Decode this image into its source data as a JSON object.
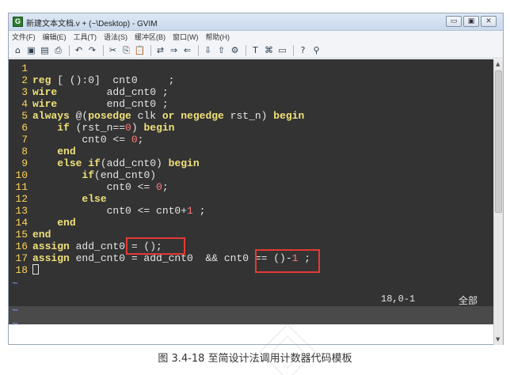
{
  "window": {
    "app_icon_letter": "G",
    "title": "新建文本文档.v + (~\\Desktop) - GVIM",
    "controls": [
      "▭",
      "▣",
      "✕"
    ]
  },
  "menu": [
    "文件(F)",
    "编辑(E)",
    "工具(T)",
    "语法(S)",
    "缓冲区(B)",
    "窗口(W)",
    "帮助(H)"
  ],
  "toolbar": {
    "icons": [
      "open-icon",
      "save-icon",
      "save-all-icon",
      "print-icon",
      "undo-icon",
      "redo-icon",
      "cut-icon",
      "copy-icon",
      "paste-icon",
      "find-replace-icon",
      "find-next-icon",
      "find-prev-icon",
      "load-session-icon",
      "save-session-icon",
      "run-script-icon",
      "make-icon",
      "shell-icon",
      "tags-icon",
      "help-icon",
      "find-help-icon"
    ],
    "glyphs": [
      "⌂",
      "▣",
      "▤",
      "⎙",
      "↶",
      "↷",
      "✂",
      "⎘",
      "📋",
      "⇄",
      "⇒",
      "⇐",
      "⇩",
      "⇧",
      "⚙",
      "T",
      "⌘",
      "▭",
      "?",
      "⚲"
    ]
  },
  "code_lines": [
    [
      {
        "t": "ln",
        "v": "1"
      }
    ],
    [
      {
        "t": "ln",
        "v": "2"
      },
      {
        "t": "kw",
        "v": "reg"
      },
      {
        "t": "txt",
        "v": " [ ():0]  cnt0     ;"
      }
    ],
    [
      {
        "t": "ln",
        "v": "3"
      },
      {
        "t": "kw",
        "v": "wire"
      },
      {
        "t": "txt",
        "v": "        add_cnt0 ;"
      }
    ],
    [
      {
        "t": "ln",
        "v": "4"
      },
      {
        "t": "kw",
        "v": "wire"
      },
      {
        "t": "txt",
        "v": "        end_cnt0 ;"
      }
    ],
    [
      {
        "t": "ln",
        "v": "5"
      },
      {
        "t": "kw",
        "v": "always"
      },
      {
        "t": "txt",
        "v": " @("
      },
      {
        "t": "kw",
        "v": "posedge"
      },
      {
        "t": "txt",
        "v": " clk "
      },
      {
        "t": "kw",
        "v": "or negedge"
      },
      {
        "t": "txt",
        "v": " rst_n) "
      },
      {
        "t": "kw",
        "v": "begin"
      }
    ],
    [
      {
        "t": "ln",
        "v": "6"
      },
      {
        "t": "txt",
        "v": "    "
      },
      {
        "t": "kw",
        "v": "if"
      },
      {
        "t": "txt",
        "v": " (rst_n=="
      },
      {
        "t": "num",
        "v": "0"
      },
      {
        "t": "txt",
        "v": ") "
      },
      {
        "t": "kw",
        "v": "begin"
      }
    ],
    [
      {
        "t": "ln",
        "v": "7"
      },
      {
        "t": "txt",
        "v": "        cnt0 <= "
      },
      {
        "t": "num",
        "v": "0"
      },
      {
        "t": "txt",
        "v": ";"
      }
    ],
    [
      {
        "t": "ln",
        "v": "8"
      },
      {
        "t": "txt",
        "v": "    "
      },
      {
        "t": "kw",
        "v": "end"
      }
    ],
    [
      {
        "t": "ln",
        "v": "9"
      },
      {
        "t": "txt",
        "v": "    "
      },
      {
        "t": "kw",
        "v": "else if"
      },
      {
        "t": "txt",
        "v": "(add_cnt0) "
      },
      {
        "t": "kw",
        "v": "begin"
      }
    ],
    [
      {
        "t": "ln",
        "v": "10"
      },
      {
        "t": "txt",
        "v": "        "
      },
      {
        "t": "kw",
        "v": "if"
      },
      {
        "t": "txt",
        "v": "(end_cnt0)"
      }
    ],
    [
      {
        "t": "ln",
        "v": "11"
      },
      {
        "t": "txt",
        "v": "            cnt0 <= "
      },
      {
        "t": "num",
        "v": "0"
      },
      {
        "t": "txt",
        "v": ";"
      }
    ],
    [
      {
        "t": "ln",
        "v": "12"
      },
      {
        "t": "txt",
        "v": "        "
      },
      {
        "t": "kw",
        "v": "else"
      }
    ],
    [
      {
        "t": "ln",
        "v": "13"
      },
      {
        "t": "txt",
        "v": "            cnt0 <= cnt0+"
      },
      {
        "t": "num",
        "v": "1"
      },
      {
        "t": "txt",
        "v": " ;"
      }
    ],
    [
      {
        "t": "ln",
        "v": "14"
      },
      {
        "t": "txt",
        "v": "    "
      },
      {
        "t": "kw",
        "v": "end"
      }
    ],
    [
      {
        "t": "ln",
        "v": "15"
      },
      {
        "t": "kw",
        "v": "end"
      }
    ],
    [
      {
        "t": "ln",
        "v": "16"
      },
      {
        "t": "kw",
        "v": "assign"
      },
      {
        "t": "txt",
        "v": " add_cnt0 = ();"
      }
    ],
    [
      {
        "t": "ln",
        "v": "17"
      },
      {
        "t": "kw",
        "v": "assign"
      },
      {
        "t": "txt",
        "v": " end_cnt0 = add_cnt0  && cnt0 == ()-"
      },
      {
        "t": "num",
        "v": "1"
      },
      {
        "t": "txt",
        "v": " ;"
      }
    ],
    [
      {
        "t": "ln",
        "v": "18"
      },
      {
        "t": "cursor",
        "v": ""
      }
    ]
  ],
  "tilde": "~",
  "status": {
    "position": "18,0-1",
    "scroll": "全部"
  },
  "caption": "图 3.4-18 至简设计法调用计数器代码模板"
}
